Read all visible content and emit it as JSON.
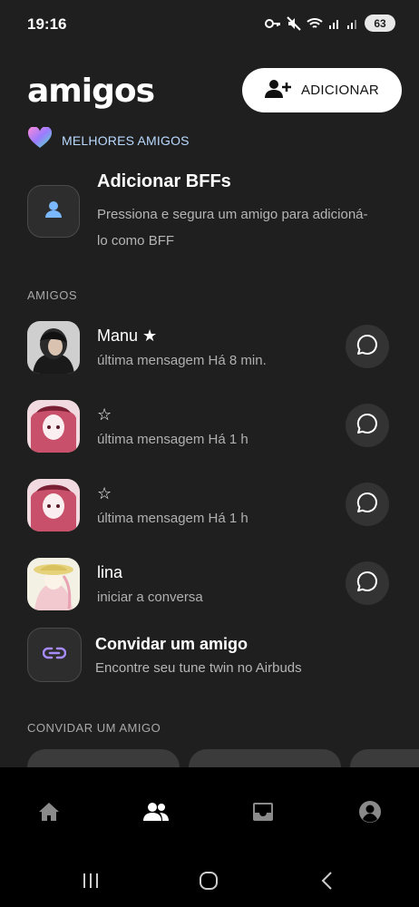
{
  "status_bar": {
    "time": "19:16",
    "battery": "63",
    "icons": [
      "key-icon",
      "mute-icon",
      "wifi-icon",
      "signal-icon",
      "signal-icon",
      "battery-icon"
    ]
  },
  "header": {
    "title": "amigos",
    "add_button_label": "ADICIONAR",
    "add_button_icon": "add-person-icon"
  },
  "best_friends": {
    "tag_label": "MELHORES AMIGOS",
    "tag_icon": "heart-icon",
    "add_title": "Adicionar BFFs",
    "add_description": "Pressiona e segura um amigo para adicioná-lo como BFF"
  },
  "friends_section": {
    "label": "AMIGOS",
    "friends": [
      {
        "name": "Manu ★",
        "subtitle": "última mensagem Há 8 min."
      },
      {
        "name": "☆",
        "subtitle": "última mensagem Há 1 h"
      },
      {
        "name": "☆",
        "subtitle": "última mensagem Há 1 h"
      },
      {
        "name": "lina",
        "subtitle": "iniciar a conversa"
      }
    ]
  },
  "invite": {
    "title": "Convidar um amigo",
    "subtitle": "Encontre seu tune twin no Airbuds",
    "section_label": "CONVIDAR UM AMIGO"
  },
  "bottom_nav": {
    "items": [
      "home-icon",
      "friends-icon",
      "inbox-icon",
      "profile-icon"
    ],
    "active": "friends-icon"
  },
  "colors": {
    "background": "#1f1f1f",
    "accent_label": "#b9d9ff",
    "link_icon": "#a78bfa"
  }
}
